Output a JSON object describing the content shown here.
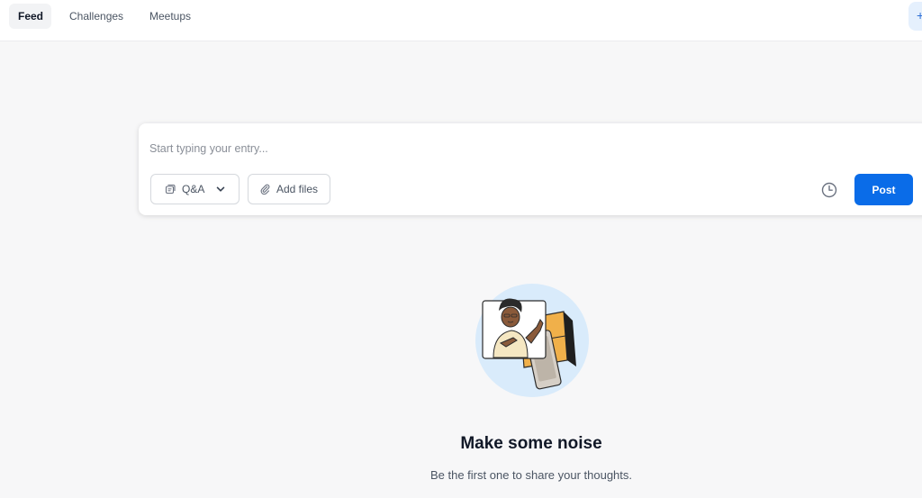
{
  "nav": {
    "tabs": [
      {
        "label": "Feed",
        "active": true
      },
      {
        "label": "Challenges",
        "active": false
      },
      {
        "label": "Meetups",
        "active": false
      }
    ],
    "corner_button_glyph": "+"
  },
  "composer": {
    "placeholder": "Start typing your entry...",
    "post_type_label": "Q&A",
    "add_files_label": "Add files",
    "post_label": "Post",
    "icons": [
      "qa-icon",
      "chevron-down-icon",
      "paperclip-icon",
      "clock-icon"
    ]
  },
  "empty_state": {
    "title": "Make some noise",
    "subtitle": "Be the first one to share your thoughts."
  },
  "colors": {
    "accent": "#0a6ce8",
    "background": "#f7f7f8",
    "illustration_circle": "#d9ebfb",
    "illustration_box": "#f0b04a"
  }
}
